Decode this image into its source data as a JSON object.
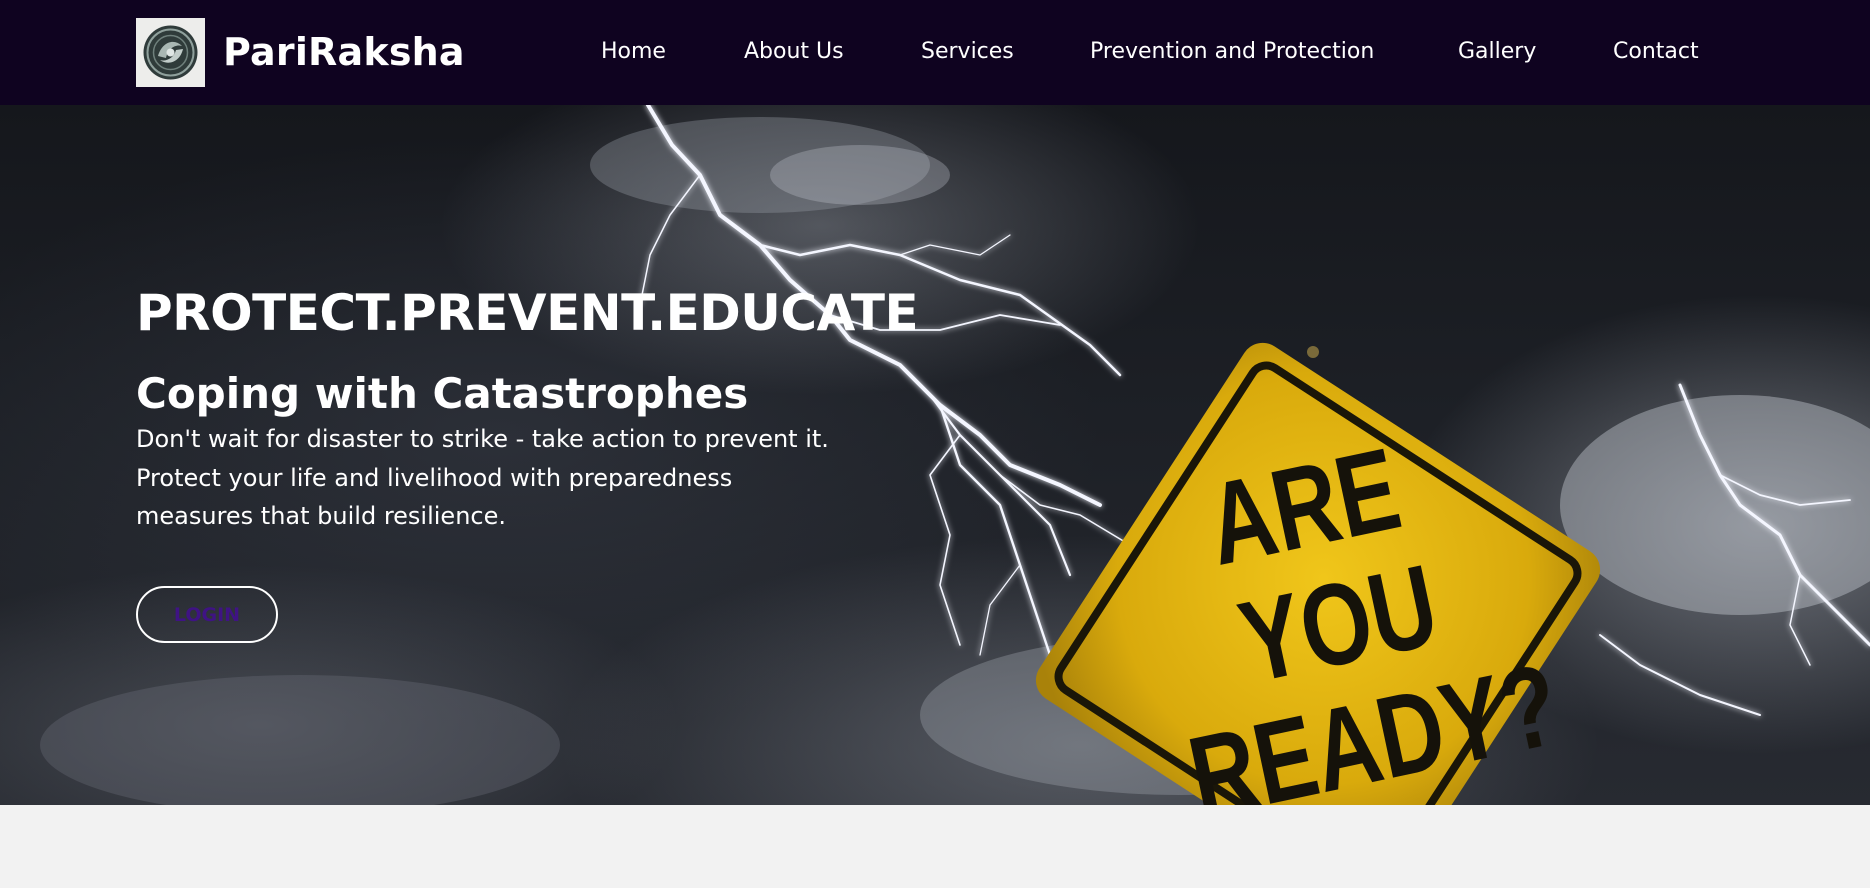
{
  "brand": {
    "name": "PariRaksha",
    "logo_icon": "emblem-logo-icon"
  },
  "nav": {
    "items": [
      {
        "label": "Home"
      },
      {
        "label": "About Us"
      },
      {
        "label": "Services"
      },
      {
        "label": "Prevention and Protection"
      },
      {
        "label": "Gallery"
      },
      {
        "label": "Contact"
      }
    ]
  },
  "hero": {
    "tagline": "PROTECT.PREVENT.EDUCATE",
    "subtitle": "Coping with Catastrophes",
    "description_lines": [
      "Don't wait for disaster to strike - take action to prevent it.",
      "Protect your life and livelihood with preparedness",
      "measures that build resilience."
    ],
    "login_label": "LOGIN",
    "sign_text": [
      "ARE",
      "YOU",
      "READY?"
    ]
  },
  "colors": {
    "navbar_bg": "#0f0320",
    "login_text": "#3f1384",
    "sign_yellow": "#e2b60f",
    "page_bg": "#f2f2f2"
  }
}
